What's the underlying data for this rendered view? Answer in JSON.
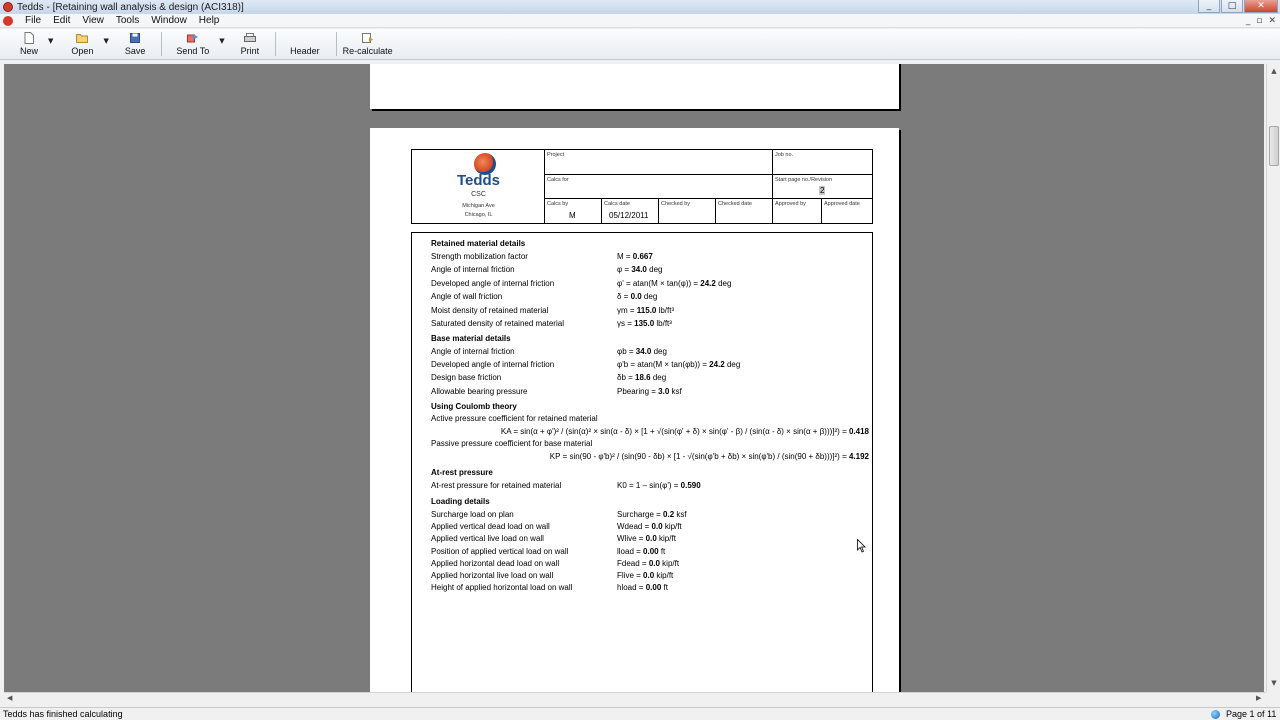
{
  "window": {
    "title": "Tedds - [Retaining wall analysis & design (ACI318)]",
    "buttons": [
      "_",
      "□",
      "✕"
    ]
  },
  "menubar": {
    "items": [
      "File",
      "Edit",
      "View",
      "Tools",
      "Window",
      "Help"
    ],
    "mdi_buttons": [
      "_",
      "▫",
      "✕"
    ]
  },
  "toolbar": {
    "new": "New",
    "open": "Open",
    "save": "Save",
    "send_to": "Send To",
    "print": "Print",
    "header": "Header",
    "recalculate": "Re-calculate"
  },
  "header_box": {
    "logo_text": "Tedds",
    "company": "CSC",
    "address_line1": "Michigan Ave",
    "address_line2": "Chicago, IL",
    "project_label": "Project",
    "job_no_label": "Job no.",
    "calcs_for_label": "Calcs for",
    "start_page_label": "Start page no./Revision",
    "start_page_value": "2",
    "calcs_by_label": "Calcs by",
    "calcs_by_value": "M",
    "calcs_date_label": "Calcs date",
    "calcs_date_value": "05/12/2011",
    "checked_by_label": "Checked by",
    "checked_date_label": "Checked date",
    "approved_by_label": "Approved by",
    "approved_date_label": "Approved date"
  },
  "calc": {
    "retained": {
      "heading": "Retained material details",
      "rows": [
        {
          "label": "Strength mobilization factor",
          "pre": "M = ",
          "val": "0.667",
          "post": ""
        },
        {
          "label": "Angle of internal friction",
          "pre": "φ = ",
          "val": "34.0",
          "post": " deg"
        },
        {
          "label": "Developed angle of internal friction",
          "pre": "φ' = atan(M × tan(φ)) = ",
          "val": "24.2",
          "post": " deg"
        },
        {
          "label": "Angle of wall friction",
          "pre": "δ = ",
          "val": "0.0",
          "post": " deg"
        },
        {
          "label": "Moist density of retained material",
          "pre": "γm = ",
          "val": "115.0",
          "post": " lb/ft³"
        },
        {
          "label": "Saturated density of retained material",
          "pre": "γs = ",
          "val": "135.0",
          "post": " lb/ft³"
        }
      ]
    },
    "base": {
      "heading": "Base material details",
      "rows": [
        {
          "label": "Angle of internal friction",
          "pre": "φb = ",
          "val": "34.0",
          "post": " deg"
        },
        {
          "label": "Developed angle of internal friction",
          "pre": "φ'b = atan(M × tan(φb)) = ",
          "val": "24.2",
          "post": " deg"
        },
        {
          "label": "Design base friction",
          "pre": "δb = ",
          "val": "18.6",
          "post": " deg"
        },
        {
          "label": "Allowable bearing pressure",
          "pre": "Pbearing = ",
          "val": "3.0",
          "post": " ksf"
        }
      ]
    },
    "coulomb": {
      "heading": "Using Coulomb theory",
      "active_label": "Active pressure coefficient for retained material",
      "active_formula": "KA = sin(α + φ')² / (sin(α)² × sin(α - δ) × [1 + √(sin(φ' + δ) × sin(φ' - β) / (sin(α - δ) × sin(α + β)))]²) = ",
      "active_value": "0.418",
      "passive_label": "Passive pressure coefficient for base material",
      "passive_formula": "KP = sin(90 - φ'b)² / (sin(90 - δb) × [1 - √(sin(φ'b + δb) × sin(φ'b) / (sin(90 + δb)))]²) = ",
      "passive_value": "4.192"
    },
    "atrest": {
      "heading": "At-rest pressure",
      "label": "At-rest pressure for retained material",
      "pre": "K0 = 1 – sin(φ') = ",
      "val": "0.590"
    },
    "loading": {
      "heading": "Loading details",
      "rows": [
        {
          "label": "Surcharge load on plan",
          "pre": "Surcharge = ",
          "val": "0.2",
          "post": " ksf"
        },
        {
          "label": "Applied vertical dead load on wall",
          "pre": "Wdead = ",
          "val": "0.0",
          "post": " kip/ft"
        },
        {
          "label": "Applied vertical live load on wall",
          "pre": "Wlive = ",
          "val": "0.0",
          "post": " kip/ft"
        },
        {
          "label": "Position of applied vertical load on wall",
          "pre": "lload = ",
          "val": "0.00",
          "post": " ft"
        },
        {
          "label": "Applied horizontal dead load on wall",
          "pre": "Fdead = ",
          "val": "0.0",
          "post": " kip/ft"
        },
        {
          "label": "Applied horizontal live load on wall",
          "pre": "Flive = ",
          "val": "0.0",
          "post": " kip/ft"
        },
        {
          "label": "Height of applied horizontal load on wall",
          "pre": "hload = ",
          "val": "0.00",
          "post": " ft"
        }
      ]
    }
  },
  "statusbar": {
    "message": "Tedds has finished calculating",
    "page_info": "Page 1 of 11"
  }
}
